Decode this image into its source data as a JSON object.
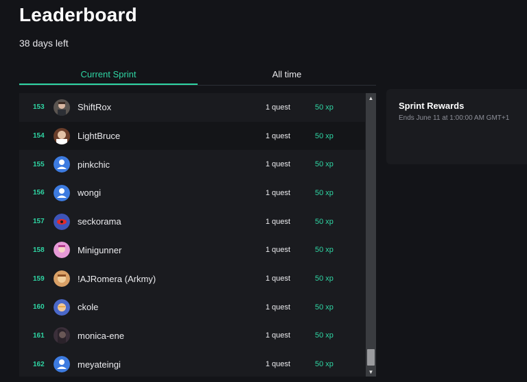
{
  "page": {
    "title": "Leaderboard",
    "days_left": "38 days left"
  },
  "tabs": [
    {
      "label": "Current Sprint",
      "active": true
    },
    {
      "label": "All time",
      "active": false
    }
  ],
  "leaderboard": {
    "rows": [
      {
        "rank": "153",
        "name": "ShiftRox",
        "quests": "1 quest",
        "xp": "50 xp",
        "avatar": "photo-man-icon"
      },
      {
        "rank": "154",
        "name": "LightBruce",
        "quests": "1 quest",
        "xp": "50 xp",
        "avatar": "photo-person-icon"
      },
      {
        "rank": "155",
        "name": "pinkchic",
        "quests": "1 quest",
        "xp": "50 xp",
        "avatar": "default-user-icon"
      },
      {
        "rank": "156",
        "name": "wongi",
        "quests": "1 quest",
        "xp": "50 xp",
        "avatar": "default-user-icon"
      },
      {
        "rank": "157",
        "name": "seckorama",
        "quests": "1 quest",
        "xp": "50 xp",
        "avatar": "red-eye-icon"
      },
      {
        "rank": "158",
        "name": "Minigunner",
        "quests": "1 quest",
        "xp": "50 xp",
        "avatar": "pink-character-icon"
      },
      {
        "rank": "159",
        "name": "!AJRomera (Arkmy)",
        "quests": "1 quest",
        "xp": "50 xp",
        "avatar": "orange-character-icon"
      },
      {
        "rank": "160",
        "name": "ckole",
        "quests": "1 quest",
        "xp": "50 xp",
        "avatar": "cartoon-face-icon"
      },
      {
        "rank": "161",
        "name": "monica-ene",
        "quests": "1 quest",
        "xp": "50 xp",
        "avatar": "photo-woman-icon"
      },
      {
        "rank": "162",
        "name": "meyateingi",
        "quests": "1 quest",
        "xp": "50 xp",
        "avatar": "default-user-icon"
      }
    ]
  },
  "rewards": {
    "title": "Sprint Rewards",
    "ends": "Ends June 11 at 1:00:00 AM GMT+1"
  },
  "colors": {
    "accent": "#2fd6a4",
    "background": "#131418",
    "panel": "#1a1b1f"
  }
}
